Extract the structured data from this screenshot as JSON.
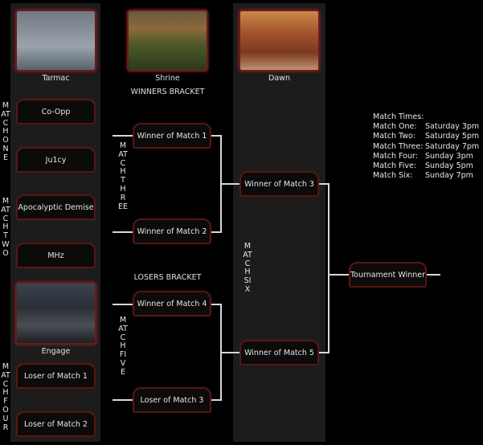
{
  "maps": [
    {
      "name": "Tarmac"
    },
    {
      "name": "Shrine"
    },
    {
      "name": "Dawn"
    },
    {
      "name": "Engage"
    }
  ],
  "headings": {
    "winners": "WINNERS BRACKET",
    "losers": "LOSERS BRACKET"
  },
  "teams": [
    "Co-Opp",
    "Ju1cy",
    "Apocalyptic Demise",
    "MHz",
    "Loser of Match 1",
    "Loser of Match 2"
  ],
  "round2": [
    "Winner of Match 1",
    "Winner of Match 2",
    "Winner of Match 4",
    "Loser of Match 3"
  ],
  "round3": [
    "Winner of Match 3",
    "Winner of Match 5"
  ],
  "final": "Tournament Winner",
  "match_labels": {
    "one": "MATCHONE",
    "two": "MATCHTWO",
    "three": "MATCHTHREE",
    "four": "MATCHFOUR",
    "five": "MATCHFIVE",
    "six": "MATCHSIX"
  },
  "schedule": {
    "title": "Match Times:",
    "rows": [
      {
        "match": "Match One:",
        "time": "Saturday 3pm"
      },
      {
        "match": "Match Two:",
        "time": "Saturday 5pm"
      },
      {
        "match": "Match Three:",
        "time": "Saturday 7pm"
      },
      {
        "match": "Match Four:",
        "time": "Sunday 3pm"
      },
      {
        "match": "Match Five:",
        "time": "Sunday 5pm"
      },
      {
        "match": "Match Six:",
        "time": "Sunday 7pm"
      }
    ]
  },
  "colors": {
    "panel": "#1c1c1c",
    "box_border": "#5a1515",
    "background": "#000000"
  }
}
